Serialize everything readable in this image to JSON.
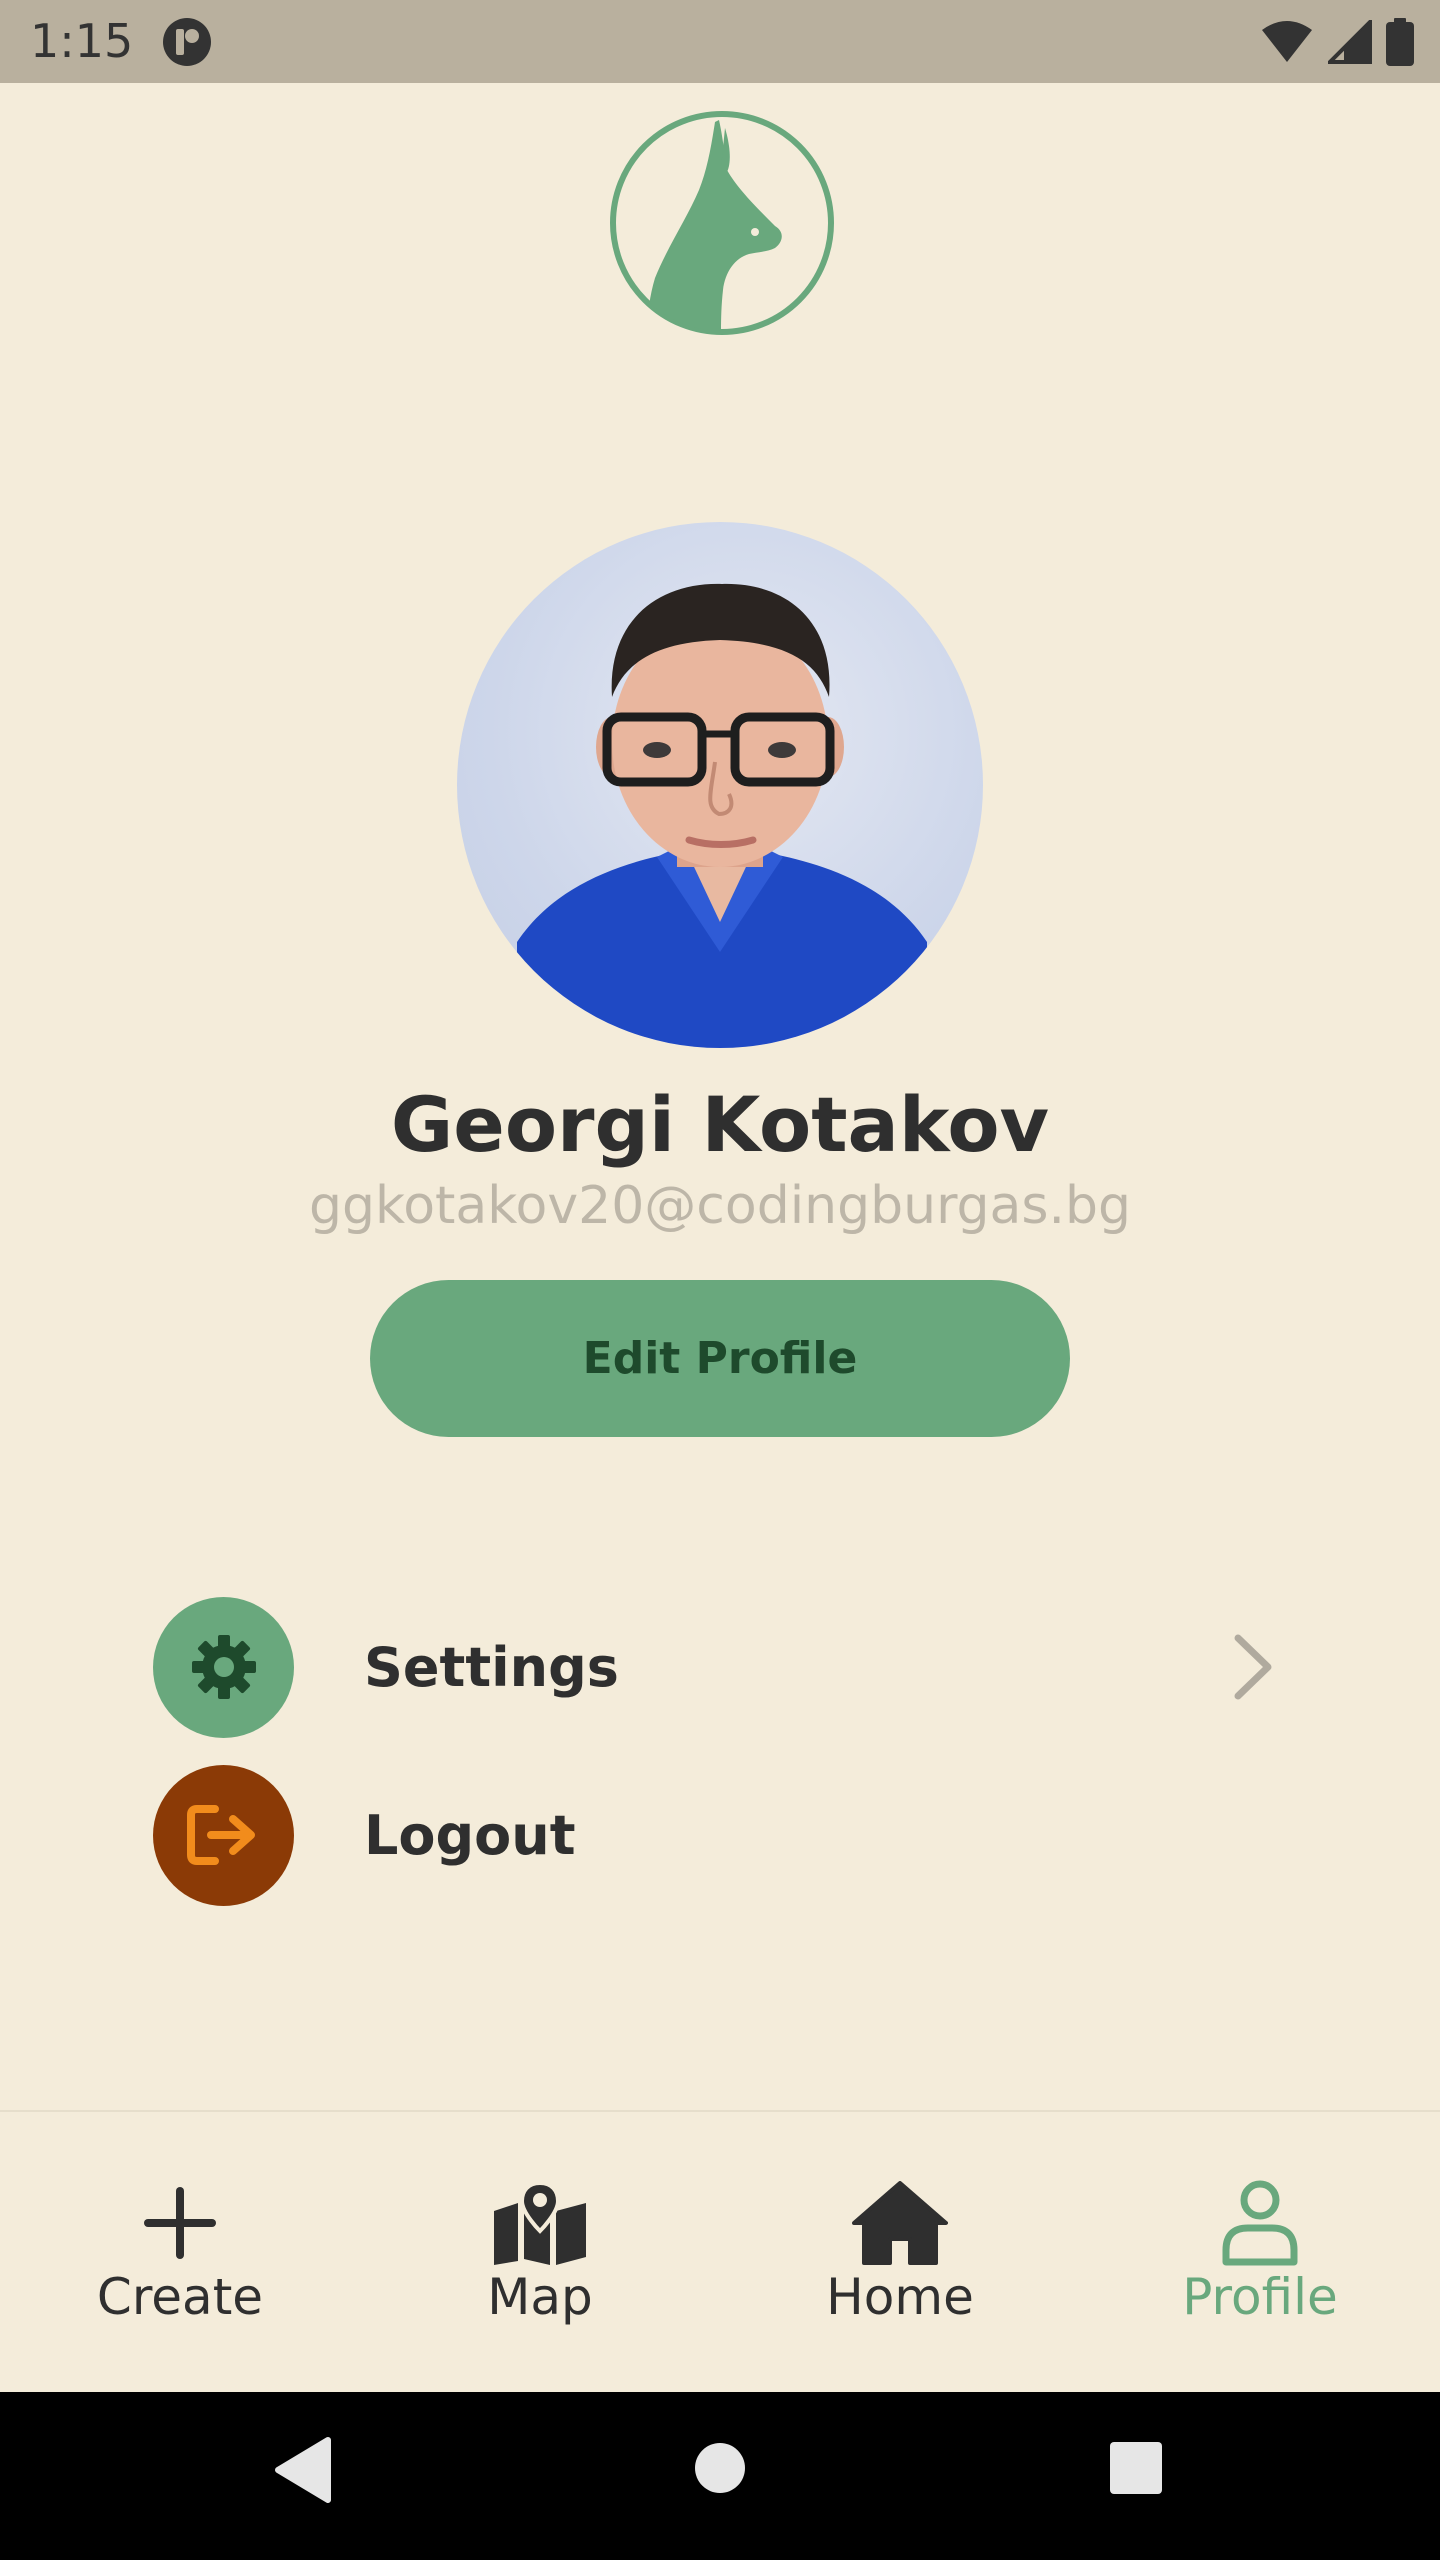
{
  "status_bar": {
    "time": "1:15"
  },
  "profile": {
    "name": "Georgi Kotakov",
    "email": "ggkotakov20@codingburgas.bg",
    "edit_button_label": "Edit Profile"
  },
  "menu": {
    "items": [
      {
        "label": "Settings",
        "icon": "gear-icon"
      },
      {
        "label": "Logout",
        "icon": "logout-icon"
      }
    ]
  },
  "bottom_nav": {
    "items": [
      {
        "label": "Create",
        "icon": "plus-icon",
        "active": false
      },
      {
        "label": "Map",
        "icon": "map-icon",
        "active": false
      },
      {
        "label": "Home",
        "icon": "home-icon",
        "active": false
      },
      {
        "label": "Profile",
        "icon": "person-icon",
        "active": true
      }
    ]
  },
  "colors": {
    "background": "#F4ECDA",
    "accent_green": "#69A87D",
    "logout_circle": "#8B3A06",
    "logout_icon": "#F28C1C",
    "status_bar": "#B9B09E"
  }
}
